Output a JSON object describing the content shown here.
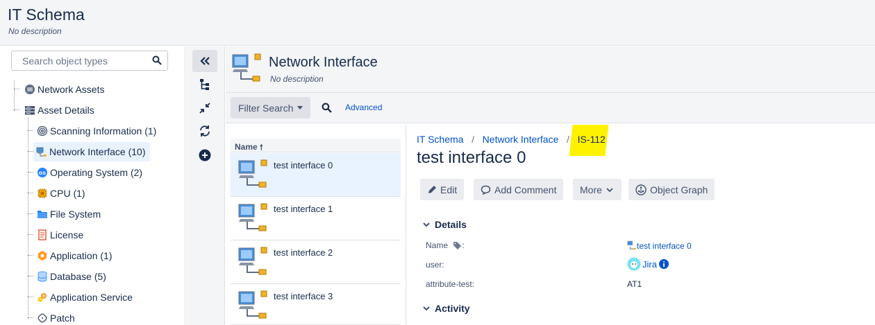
{
  "header": {
    "title": "IT Schema",
    "subtitle": "No description"
  },
  "sidebar": {
    "search_placeholder": "Search object types",
    "items": [
      {
        "label": "Network Assets",
        "icon": "network-assets-icon"
      },
      {
        "label": "Asset Details",
        "icon": "server-rack-icon"
      },
      {
        "label": "Scanning Information (1)",
        "icon": "fingerprint-icon"
      },
      {
        "label": "Network Interface (10)",
        "icon": "network-interface-icon"
      },
      {
        "label": "Operating System (2)",
        "icon": "os-icon"
      },
      {
        "label": "CPU (1)",
        "icon": "cpu-icon"
      },
      {
        "label": "File System",
        "icon": "folder-icon"
      },
      {
        "label": "License",
        "icon": "license-icon"
      },
      {
        "label": "Application (1)",
        "icon": "application-icon"
      },
      {
        "label": "Database (5)",
        "icon": "database-icon"
      },
      {
        "label": "Application Service",
        "icon": "application-service-icon"
      },
      {
        "label": "Patch",
        "icon": "patch-icon"
      }
    ]
  },
  "object_type": {
    "title": "Network Interface",
    "subtitle": "No description"
  },
  "filter": {
    "button_label": "Filter Search",
    "advanced_label": "Advanced"
  },
  "list": {
    "header": "Name",
    "rows": [
      "test interface 0",
      "test interface 1",
      "test interface 2",
      "test interface 3"
    ]
  },
  "detail": {
    "breadcrumb": [
      "IT Schema",
      "Network Interface",
      "IS-112"
    ],
    "title": "test interface 0",
    "actions": {
      "edit": "Edit",
      "comment": "Add Comment",
      "more": "More",
      "graph": "Object Graph"
    },
    "details_heading": "Details",
    "attributes": [
      {
        "label": "Name",
        "value": "test interface 0"
      },
      {
        "label": "user:",
        "value": "Jira"
      },
      {
        "label": "attribute-test:",
        "value": "AT1"
      }
    ],
    "activity_heading": "Activity"
  },
  "colors": {
    "link": "#0052cc",
    "highlight": "#fff200",
    "selected": "#e9f2ff"
  }
}
